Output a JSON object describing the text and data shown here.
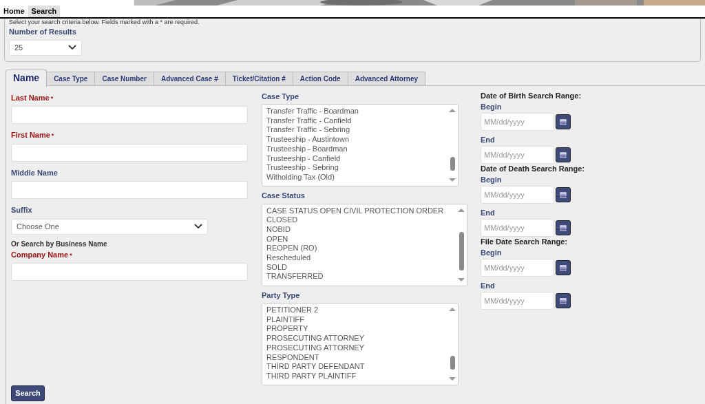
{
  "nav": [
    {
      "label": "Home",
      "selected": false
    },
    {
      "label": "Search",
      "selected": true
    }
  ],
  "instructions": "Select your search criteria below. Fields marked with a * are required.",
  "results": {
    "label": "Number of Results",
    "value": "25"
  },
  "tabs": [
    {
      "label": "Name",
      "selected": true
    },
    {
      "label": "Case Type",
      "selected": false
    },
    {
      "label": "Case Number",
      "selected": false
    },
    {
      "label": "Advanced Case #",
      "selected": false
    },
    {
      "label": "Ticket/Citation #",
      "selected": false
    },
    {
      "label": "Action Code",
      "selected": false
    },
    {
      "label": "Advanced Attorney",
      "selected": false
    }
  ],
  "name_fields": [
    {
      "kind": "input",
      "label": "Last Name",
      "required": true
    },
    {
      "kind": "input",
      "label": "First Name",
      "required": true
    },
    {
      "kind": "input",
      "label": "Middle Name",
      "required": false
    },
    {
      "kind": "select",
      "label": "Suffix",
      "required": false,
      "value": "Choose One"
    },
    {
      "kind": "note",
      "label": "Or Search by Business Name"
    },
    {
      "kind": "input",
      "label": "Company Name",
      "required": true
    }
  ],
  "required_mark": "*",
  "lists": [
    {
      "label": "Case Type",
      "wide": false,
      "items": [
        "Transfer Traffic - Boardman",
        "Transfer Traffic - Canfield",
        "Transfer Traffic - Sebring",
        "Trusteeship - Austintown",
        "Trusteeship - Boardman",
        "Trusteeship - Canfield",
        "Trusteeship - Sebring",
        "Witholding Tax (Old)"
      ]
    },
    {
      "label": "Case Status",
      "wide": true,
      "items": [
        "CASE STATUS OPEN CIVIL PROTECTION ORDER",
        "CLOSED",
        "NOBID",
        "OPEN",
        "REOPEN (RO)",
        "Rescheduled",
        "SOLD",
        "TRANSFERRED"
      ]
    },
    {
      "label": "Party Type",
      "wide": false,
      "items": [
        "PETITIONER 2",
        "PLAINTIFF",
        "PROPERTY",
        "PROSECUTING ATTORNEY",
        "PROSECUTING ATTORNEY",
        "RESPONDENT",
        "THIRD PARTY DEFENDANT",
        "THIRD PARTY PLAINTIFF"
      ]
    }
  ],
  "date_ranges": [
    {
      "title": "Date of Birth Search Range:",
      "fields": [
        {
          "label": "Begin",
          "placeholder": "MM/dd/yyyy"
        },
        {
          "label": "End",
          "placeholder": "MM/dd/yyyy"
        }
      ]
    },
    {
      "title": "Date of Death Search Range:",
      "fields": [
        {
          "label": "Begin",
          "placeholder": "MM/dd/yyyy"
        },
        {
          "label": "End",
          "placeholder": "MM/dd/yyyy"
        }
      ]
    },
    {
      "title": "File Date Search Range:",
      "fields": [
        {
          "label": "Begin",
          "placeholder": "MM/dd/yyyy"
        },
        {
          "label": "End",
          "placeholder": "MM/dd/yyyy"
        }
      ]
    }
  ],
  "search_button": "Search"
}
